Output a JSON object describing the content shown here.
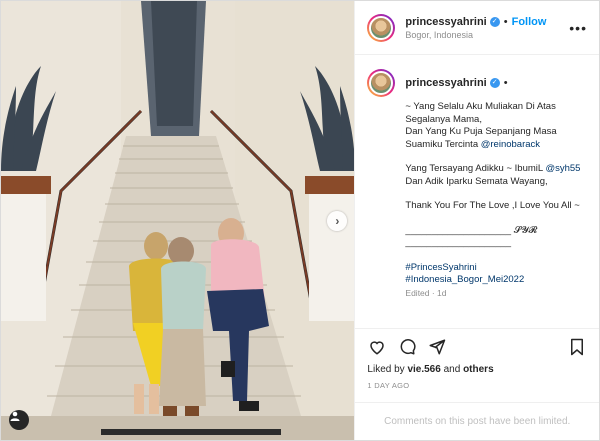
{
  "post": {
    "username": "princessyahrini",
    "location": "Bogor, Indonesia",
    "follow_label": "Follow",
    "separator": "•",
    "more_label": "•••"
  },
  "caption": {
    "username": "princessyahrini",
    "separator": "•",
    "line1": "~ Yang Selalu Aku Muliakan Di Atas",
    "line2": "Segalanya Mama,",
    "line3": "Dan Yang Ku Puja Sepanjang Masa",
    "line4_text": "Suamiku Tercinta ",
    "line4_mention": "@reinobarack",
    "line5_text": "Yang Tersayang Adikku ~ IbumiL ",
    "line5_mention": "@syh55",
    "line6": "Dan Adik Iparku Semata Wayang,",
    "line7": "Thank You For The Love ,I Love You All ~",
    "line8": "____________________ 𝓢𝓨𝓡",
    "line9": "____________________",
    "hashtag1": "#PrincesSyahrini",
    "hashtag2": "#Indonesia_Bogor_Mei2022",
    "edited": "Edited · 1d"
  },
  "engagement": {
    "liked_by_prefix": "Liked by ",
    "liked_by_user": "vie.566",
    "liked_by_and": " and ",
    "liked_by_others": "others",
    "time_ago": "1 DAY AGO",
    "comments_disabled": "Comments on this post have been limited."
  },
  "icons": {
    "like": "heart-icon",
    "comment": "comment-icon",
    "share": "send-icon",
    "save": "bookmark-icon",
    "next": "chevron-right-icon",
    "tag": "user-tag-icon"
  },
  "colors": {
    "accent": "#0095f6",
    "verified": "#3897f0",
    "link": "#00376b",
    "muted": "#8e8e8e"
  }
}
